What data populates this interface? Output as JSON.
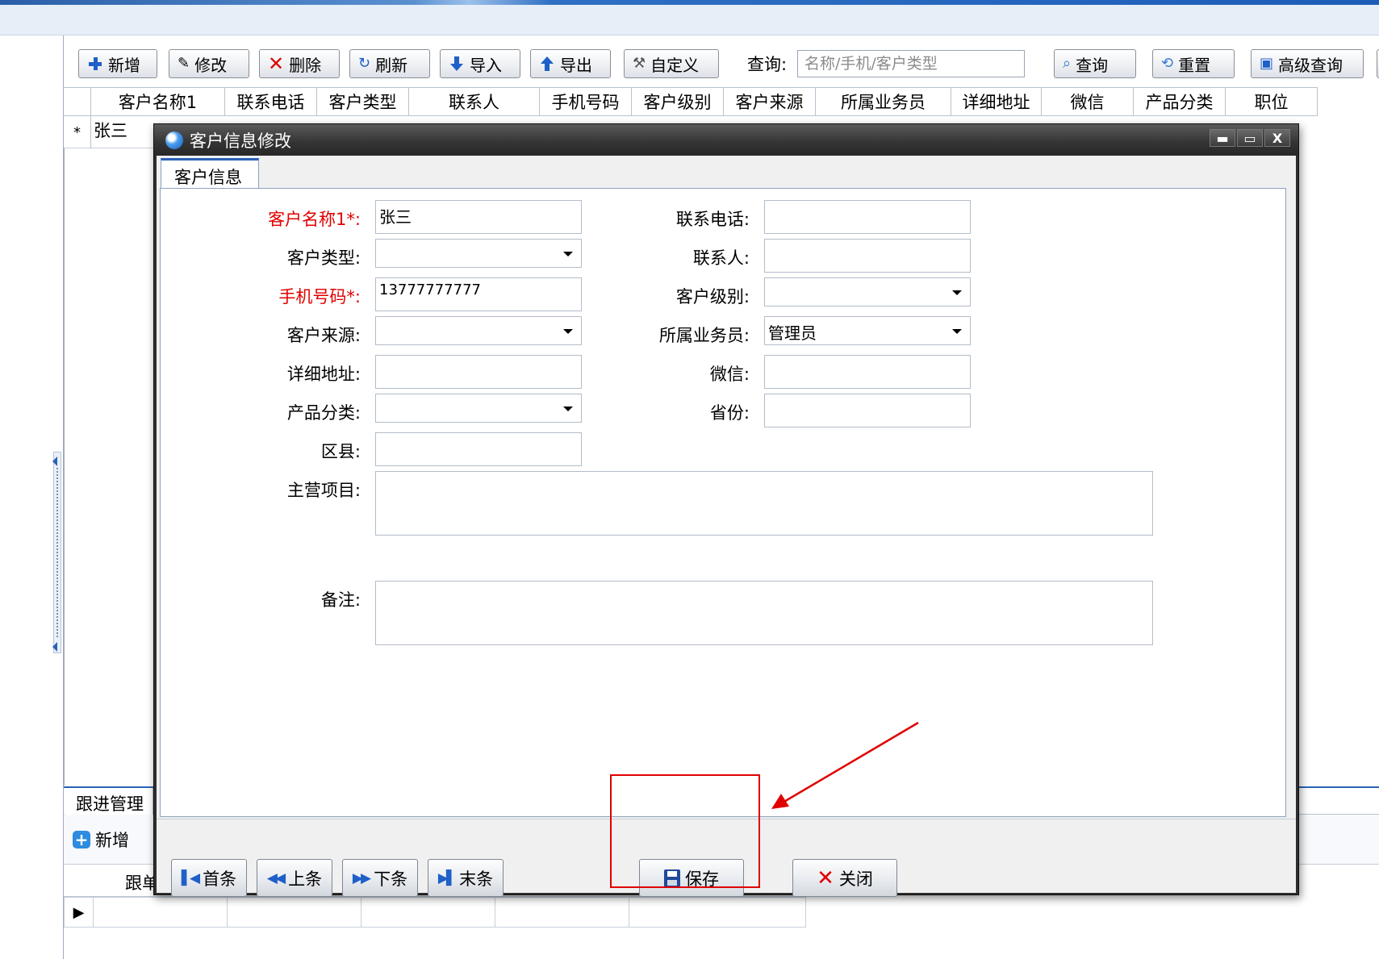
{
  "toolbar": {
    "new_label": "新增",
    "edit_label": "修改",
    "delete_label": "删除",
    "refresh_label": "刷新",
    "import_label": "导入",
    "export_label": "导出",
    "custom_label": "自定义",
    "query_label": "查询:",
    "query_placeholder": "名称/手机/客户类型",
    "search_label": "查询",
    "reset_label": "重置",
    "advanced_label": "高级查询"
  },
  "grid": {
    "columns": [
      "客户名称1",
      "联系电话",
      "客户类型",
      "联系人",
      "手机号码",
      "客户级别",
      "客户来源",
      "所属业务员",
      "详细地址",
      "微信",
      "产品分类",
      "职位"
    ],
    "rows": [
      {
        "indicator": "*",
        "name": "张三"
      }
    ]
  },
  "lower_panel": {
    "tab_label": "跟进管理",
    "new_label": "新增",
    "first_col_label": "跟单",
    "row_indicator": "▶"
  },
  "dialog": {
    "title": "客户信息修改",
    "tab_label": "客户信息",
    "fields": {
      "customer_name": {
        "label": "客户名称1*:",
        "value": "张三"
      },
      "phone": {
        "label": "联系电话:",
        "value": ""
      },
      "customer_type": {
        "label": "客户类型:",
        "value": ""
      },
      "contact": {
        "label": "联系人:",
        "value": ""
      },
      "mobile": {
        "label": "手机号码*:",
        "value": "13777777777"
      },
      "customer_level": {
        "label": "客户级别:",
        "value": ""
      },
      "customer_source": {
        "label": "客户来源:",
        "value": ""
      },
      "salesperson": {
        "label": "所属业务员:",
        "value": "管理员"
      },
      "address": {
        "label": "详细地址:",
        "value": ""
      },
      "wechat": {
        "label": "微信:",
        "value": ""
      },
      "product_category": {
        "label": "产品分类:",
        "value": ""
      },
      "province": {
        "label": "省份:",
        "value": ""
      },
      "county": {
        "label": "区县:",
        "value": ""
      },
      "main_business": {
        "label": "主营项目:",
        "value": ""
      },
      "remarks": {
        "label": "备注:",
        "value": ""
      }
    },
    "buttons": {
      "first": "首条",
      "prev": "上条",
      "next": "下条",
      "last": "末条",
      "save": "保存",
      "close": "关闭"
    }
  },
  "colors": {
    "required_label": "#e00000",
    "accent_blue": "#1f5fc8",
    "annotation_red": "#e00000"
  }
}
